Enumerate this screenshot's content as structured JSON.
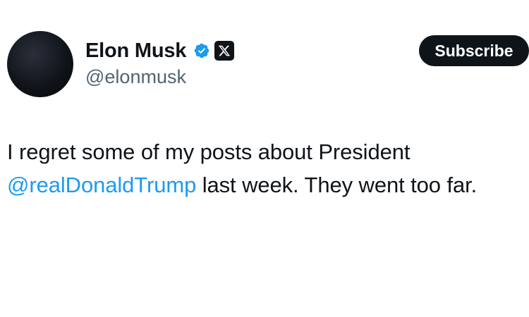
{
  "author": {
    "display_name": "Elon Musk",
    "handle": "@elonmusk",
    "avatar_icon": "avatar-image",
    "verified_icon": "verified-badge-icon",
    "affiliation_icon": "x-logo-icon",
    "verified_color": "#1d9bf0"
  },
  "actions": {
    "subscribe_label": "Subscribe"
  },
  "post": {
    "text_part1": "I regret some of my posts about President ",
    "mention": "@realDonaldTrump",
    "text_part2": " last week. They went too far.",
    "mention_color": "#1d9bf0"
  }
}
